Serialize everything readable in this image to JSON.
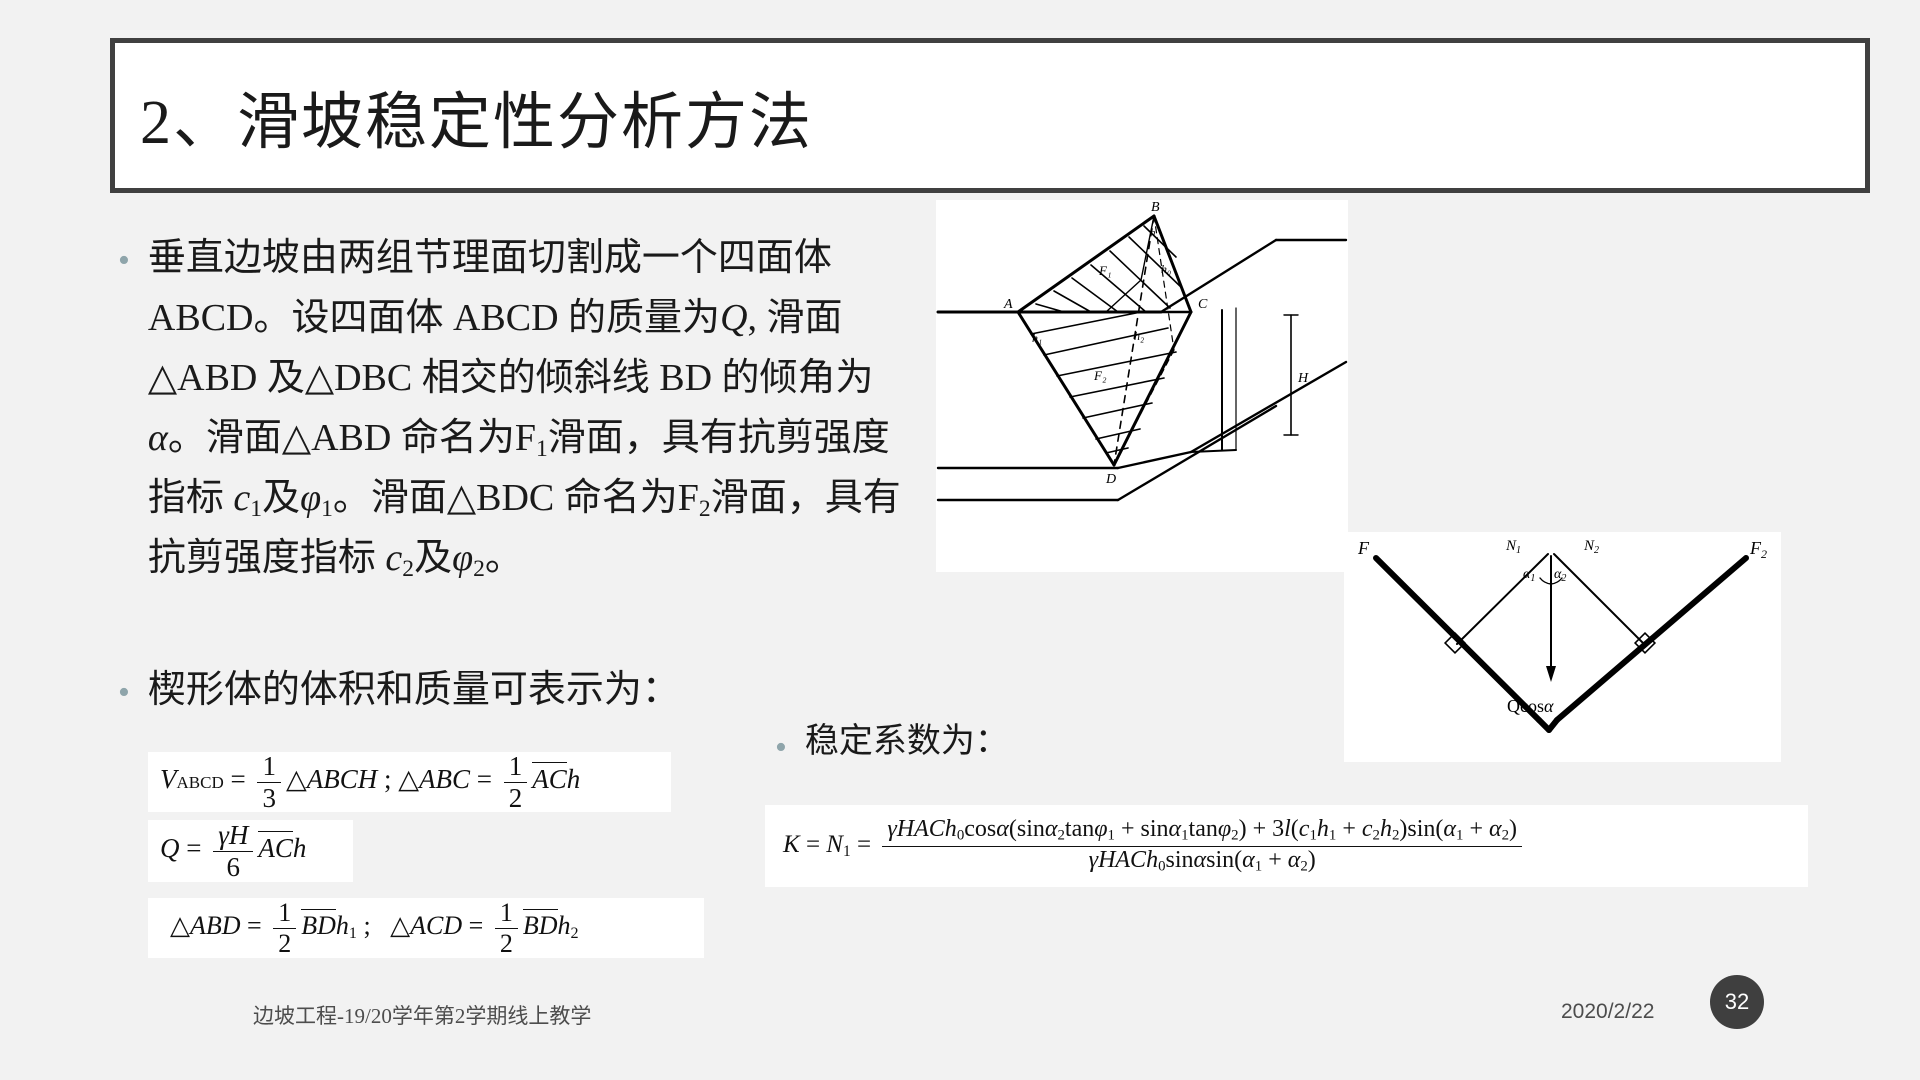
{
  "slide": {
    "title": "2、滑坡稳定性分析方法",
    "background_color": "#f2f2f2",
    "title_border_color": "#404040",
    "bullet_color": "#8fa5ab"
  },
  "bullets": [
    {
      "id": "b1",
      "segments": [
        {
          "t": "垂直边坡由两组节理面切割成一个四面体ABCD。设四面体 ABCD 的质量为",
          "s": "n"
        },
        {
          "t": "Q",
          "s": "i"
        },
        {
          "t": ", 滑面△ABD 及△DBC 相交的倾斜线 BD 的倾角为",
          "s": "n"
        },
        {
          "t": "α",
          "s": "i"
        },
        {
          "t": "。滑面△ABD 命名为F",
          "s": "n"
        },
        {
          "t": "1",
          "s": "sub"
        },
        {
          "t": "滑面，具有抗剪强度指标 ",
          "s": "n"
        },
        {
          "t": "c",
          "s": "i"
        },
        {
          "t": "1",
          "s": "sub"
        },
        {
          "t": "及",
          "s": "n"
        },
        {
          "t": "φ",
          "s": "i"
        },
        {
          "t": "1",
          "s": "sub"
        },
        {
          "t": "。滑面△BDC 命名为F",
          "s": "n"
        },
        {
          "t": "2",
          "s": "sub"
        },
        {
          "t": "滑面，具有抗剪强度指标 ",
          "s": "n"
        },
        {
          "t": "c",
          "s": "i"
        },
        {
          "t": "2",
          "s": "sub"
        },
        {
          "t": "及",
          "s": "n"
        },
        {
          "t": "φ",
          "s": "i"
        },
        {
          "t": "2",
          "s": "sub"
        },
        {
          "t": "。",
          "s": "n"
        }
      ],
      "plain": "垂直边坡由两组节理面切割成一个四面体ABCD。设四面体 ABCD 的质量为Q, 滑面△ABD 及△DBC 相交的倾斜线 BD 的倾角为α。滑面△ABD 命名为F1滑面，具有抗剪强度指标 c1及φ1。滑面△BDC 命名为F2滑面，具有抗剪强度指标 c2及φ2。"
    },
    {
      "id": "b2",
      "plain": "楔形体的体积和质量可表示为："
    },
    {
      "id": "b3",
      "plain": "稳定系数为："
    }
  ],
  "formulas": {
    "volume": {
      "lhs": "V",
      "lhs_sub": "ABCD",
      "eq": "=",
      "frac_num": "1",
      "frac_den": "3",
      "body": "△ABCH",
      "sep": ";",
      "second_lhs": "△ABC",
      "second_eq": "=",
      "second_num": "1",
      "second_den": "2",
      "second_body": "AC",
      "second_tail": "h",
      "plain": "V_ABCD = 1/3 △ABCH ; △ABC = 1/2 ‾AC‾h"
    },
    "mass": {
      "lhs": "Q",
      "eq": "=",
      "frac_num": "γH",
      "frac_den": "6",
      "body": "AC",
      "tail": "h",
      "plain": "Q = γH/6 ‾AC‾h"
    },
    "areas": {
      "first_lhs": "△ABD",
      "first_eq": "=",
      "first_num": "1",
      "first_den": "2",
      "first_body": "BD",
      "first_tail": "h",
      "first_tail_sub": "1",
      "sep": ";",
      "second_lhs": "△ACD",
      "second_eq": "=",
      "second_num": "1",
      "second_den": "2",
      "second_body": "BD",
      "second_tail": "h",
      "second_tail_sub": "2",
      "plain": "△ABD = 1/2 ‾BD‾h₁ ;  △ACD = 1/2 ‾BD‾h₂"
    },
    "stability": {
      "lhs": "K = N",
      "lhs_sub": "1",
      "eq": "=",
      "numerator": "γHACh₀cosα(sinα₂tanφ₁ + sinα₁tanφ₂) + 3l(c₁h₁ + c₂h₂)sin(α₁ + α₂)",
      "denominator": "γHACh₀sinαsin(α₁ + α₂)",
      "plain": "K = N₁ = [γHACh₀cosα(sinα₂tanφ₁ + sinα₁tanφ₂) + 3l(c₁h₁ + c₂h₂)sin(α₁ + α₂)] / [γHACh₀sinαsin(α₁ + α₂)]"
    }
  },
  "figures": {
    "wedge": {
      "name": "wedge-block-3d-diagram",
      "labels": [
        "B",
        "A",
        "C",
        "D",
        "H",
        "F₁",
        "F₂",
        "h₀",
        "h₁",
        "h₂"
      ]
    },
    "forces": {
      "name": "force-polygon-diagram",
      "labels": [
        "F",
        "F₂",
        "N₁",
        "N₂",
        "α₁",
        "α₂",
        "Qcosα"
      ]
    }
  },
  "footer": {
    "course": "边坡工程-19/20学年第2学期线上教学",
    "date": "2020/2/22",
    "page_number": "32"
  }
}
